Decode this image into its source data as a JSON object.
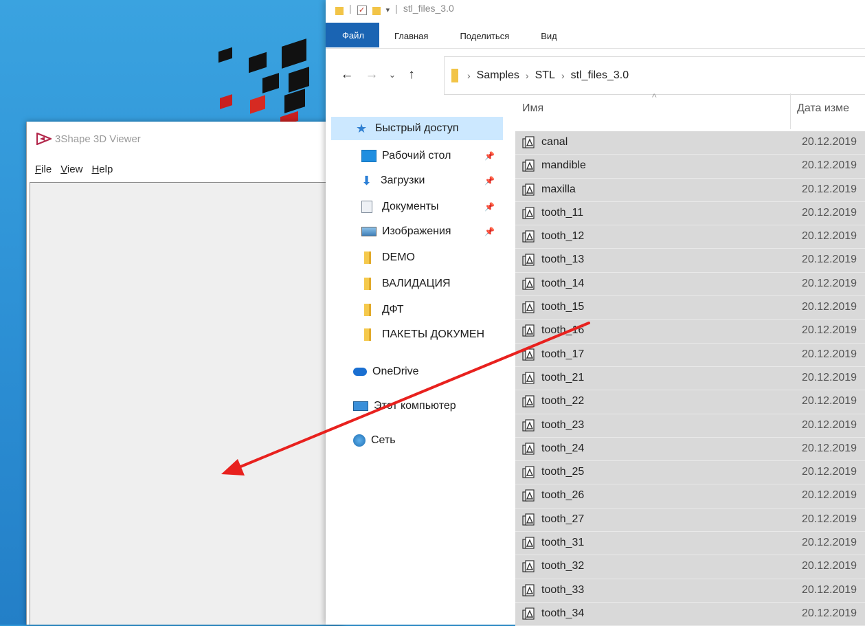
{
  "viewer": {
    "title": "3Shape 3D Viewer",
    "menu": [
      "File",
      "View",
      "Help"
    ]
  },
  "explorer": {
    "qat_title": "stl_files_3.0",
    "ribbon_tabs": [
      "Файл",
      "Главная",
      "Поделиться",
      "Вид"
    ],
    "breadcrumb": [
      "Samples",
      "STL",
      "stl_files_3.0"
    ],
    "nav": {
      "quick_access": "Быстрый доступ",
      "pinned": [
        "Рабочий стол",
        "Загрузки",
        "Документы",
        "Изображения"
      ],
      "folders": [
        "DEMO",
        "ВАЛИДАЦИЯ",
        "ДФТ",
        "ПАКЕТЫ ДОКУМЕН"
      ],
      "onedrive": "OneDrive",
      "this_pc": "Этот компьютер",
      "network": "Сеть"
    },
    "columns": {
      "name": "Имя",
      "date": "Дата изме"
    },
    "files": [
      {
        "name": "canal",
        "date": "20.12.2019"
      },
      {
        "name": "mandible",
        "date": "20.12.2019"
      },
      {
        "name": "maxilla",
        "date": "20.12.2019"
      },
      {
        "name": "tooth_11",
        "date": "20.12.2019"
      },
      {
        "name": "tooth_12",
        "date": "20.12.2019"
      },
      {
        "name": "tooth_13",
        "date": "20.12.2019"
      },
      {
        "name": "tooth_14",
        "date": "20.12.2019"
      },
      {
        "name": "tooth_15",
        "date": "20.12.2019"
      },
      {
        "name": "tooth_16",
        "date": "20.12.2019"
      },
      {
        "name": "tooth_17",
        "date": "20.12.2019"
      },
      {
        "name": "tooth_21",
        "date": "20.12.2019"
      },
      {
        "name": "tooth_22",
        "date": "20.12.2019"
      },
      {
        "name": "tooth_23",
        "date": "20.12.2019"
      },
      {
        "name": "tooth_24",
        "date": "20.12.2019"
      },
      {
        "name": "tooth_25",
        "date": "20.12.2019"
      },
      {
        "name": "tooth_26",
        "date": "20.12.2019"
      },
      {
        "name": "tooth_27",
        "date": "20.12.2019"
      },
      {
        "name": "tooth_31",
        "date": "20.12.2019"
      },
      {
        "name": "tooth_32",
        "date": "20.12.2019"
      },
      {
        "name": "tooth_33",
        "date": "20.12.2019"
      },
      {
        "name": "tooth_34",
        "date": "20.12.2019"
      }
    ]
  },
  "colors": {
    "accent": "#1a64b3",
    "selection": "#d9d9d9",
    "arrow": "#e8211e"
  }
}
